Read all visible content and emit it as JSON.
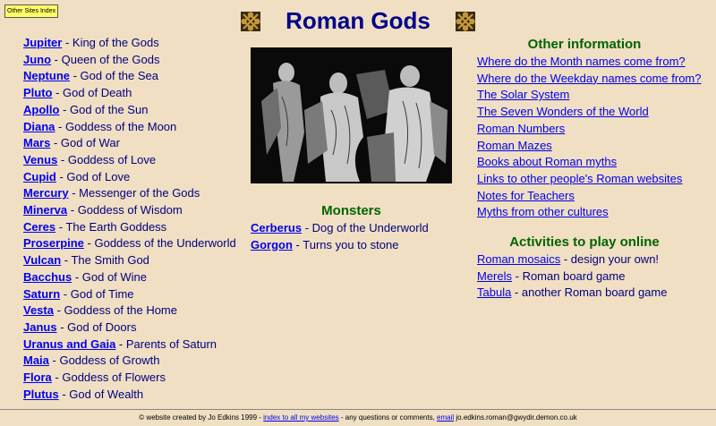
{
  "other_sites": "Other Sites Index",
  "title": "Roman Gods",
  "gods": [
    {
      "name": "Jupiter",
      "desc": " - King of the Gods"
    },
    {
      "name": "Juno",
      "desc": " - Queen of the Gods"
    },
    {
      "name": "Neptune",
      "desc": " - God of the Sea"
    },
    {
      "name": "Pluto",
      "desc": " - God of Death"
    },
    {
      "name": "Apollo",
      "desc": " - God of the Sun"
    },
    {
      "name": "Diana",
      "desc": " - Goddess of the Moon"
    },
    {
      "name": "Mars",
      "desc": " - God of War"
    },
    {
      "name": "Venus",
      "desc": " - Goddess of Love"
    },
    {
      "name": "Cupid",
      "desc": " - God of Love"
    },
    {
      "name": "Mercury",
      "desc": " - Messenger of the Gods"
    },
    {
      "name": "Minerva",
      "desc": " - Goddess of Wisdom"
    },
    {
      "name": "Ceres",
      "desc": " - The Earth Goddess"
    },
    {
      "name": "Proserpine",
      "desc": " - Goddess of the Underworld"
    },
    {
      "name": "Vulcan",
      "desc": " - The Smith God"
    },
    {
      "name": "Bacchus",
      "desc": " - God of Wine"
    },
    {
      "name": "Saturn",
      "desc": " - God of Time"
    },
    {
      "name": "Vesta",
      "desc": " - Goddess of the Home"
    },
    {
      "name": "Janus",
      "desc": " - God of Doors"
    },
    {
      "name": "Uranus and Gaia",
      "desc": " - Parents of Saturn"
    },
    {
      "name": "Maia",
      "desc": " - Goddess of Growth"
    },
    {
      "name": "Flora",
      "desc": " - Goddess of Flowers"
    },
    {
      "name": "Plutus",
      "desc": " - God of Wealth"
    }
  ],
  "monsters": {
    "heading": "Monsters",
    "items": [
      {
        "name": "Cerberus",
        "desc": " - Dog of the Underworld"
      },
      {
        "name": "Gorgon",
        "desc": " - Turns you to stone"
      }
    ]
  },
  "other_info": {
    "heading": "Other information",
    "links": [
      "Where do the Month names come from?",
      "Where do the Weekday names come from?",
      "The Solar System",
      "The Seven Wonders of the World",
      "Roman Numbers",
      "Roman Mazes",
      "Books about Roman myths",
      "Links to other people's Roman websites",
      "Notes for Teachers",
      "Myths from other cultures"
    ]
  },
  "activities": {
    "heading": "Activities to play online",
    "items": [
      {
        "name": "Roman mosaics",
        "desc": " - design your own!"
      },
      {
        "name": "Merels",
        "desc": " - Roman board game"
      },
      {
        "name": "Tabula",
        "desc": " - another Roman board game"
      }
    ]
  },
  "footer": {
    "prefix": "© website created by Jo Edkins 1999 - ",
    "index_link": "index to all my websites",
    "middle": " - any questions or comments, ",
    "email_link": "email",
    "email_addr": " jo.edkins.roman@gwydir.demon.co.uk"
  }
}
